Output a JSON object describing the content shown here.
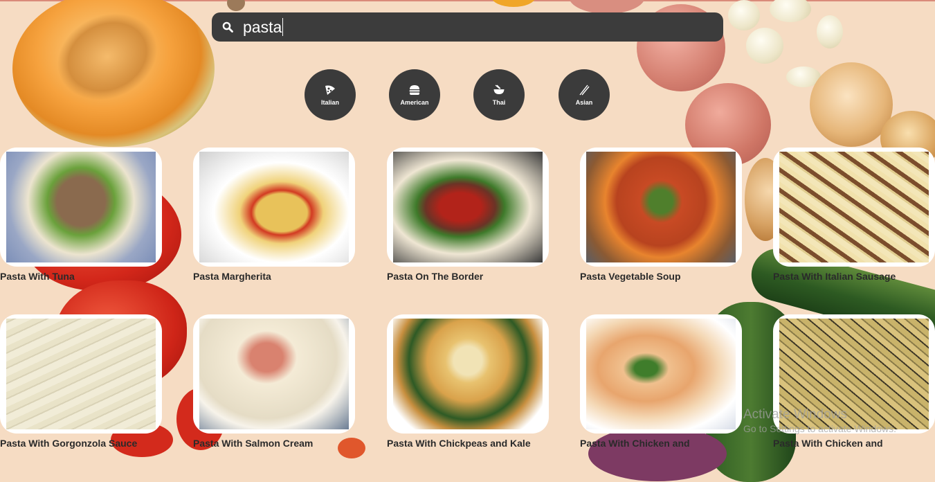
{
  "search": {
    "value": "pasta"
  },
  "categories": [
    {
      "label": "Italian",
      "icon": "pizza-icon"
    },
    {
      "label": "American",
      "icon": "burger-icon"
    },
    {
      "label": "Thai",
      "icon": "noodle-bowl-icon"
    },
    {
      "label": "Asian",
      "icon": "chopsticks-icon"
    }
  ],
  "recipes": [
    {
      "title": "Pasta With Tuna"
    },
    {
      "title": "Pasta Margherita"
    },
    {
      "title": "Pasta On The Border"
    },
    {
      "title": "Pasta Vegetable Soup"
    },
    {
      "title": "Pasta With Italian Sausage"
    },
    {
      "title": "Pasta With Gorgonzola Sauce"
    },
    {
      "title": "Pasta With Salmon Cream"
    },
    {
      "title": "Pasta With Chickpeas and Kale"
    },
    {
      "title": "Pasta With Chicken and"
    },
    {
      "title": "Pasta With Chicken and"
    }
  ],
  "watermark": {
    "line1": "Activate Windows",
    "line2": "Go to Settings to activate Windows."
  },
  "colors": {
    "search_bg": "#3c3c3c",
    "category_bg": "#3b3b3b",
    "page_bg": "#f6dcc3"
  }
}
